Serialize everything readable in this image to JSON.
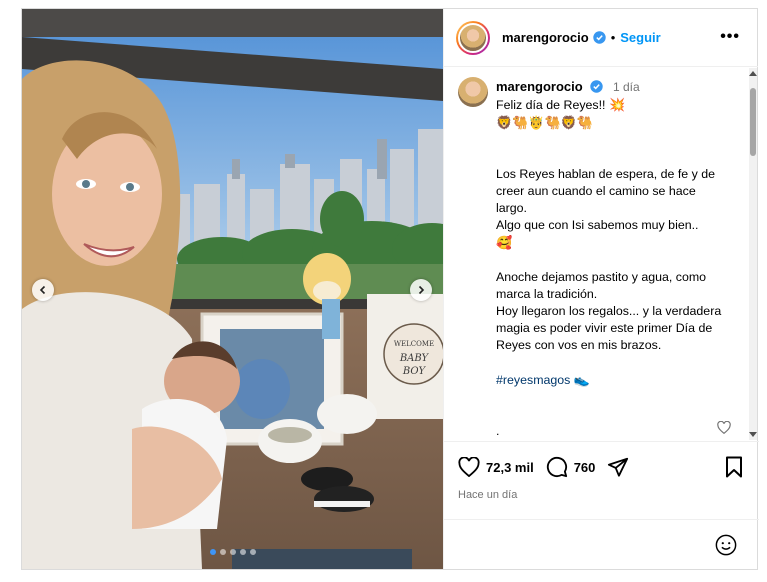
{
  "post": {
    "username": "marengorocio",
    "follow_label": "Seguir",
    "separator": "•",
    "more_label": "•••",
    "time_ago": "1 día",
    "caption_line1": "Feliz día de Reyes!! ",
    "caption_line1_emoji": "💥",
    "caption_emoji_row": "🦁🐫🤴🐫🦁🐫",
    "caption_p1": "Los Reyes hablan de espera, de fe y de creer aun cuando el camino se hace largo.\nAlgo que con Isi sabemos muy bien..",
    "caption_p1_emoji": "🥰",
    "caption_p2": "Anoche dejamos pastito y agua, como marca la tradición.\nHoy llegaron los regalos... y la verdadera magia es poder vivir este primer Día de Reyes con vos en mis brazos.",
    "hashtag": "#reyesmagos",
    "hashtag_emoji": "👟",
    "partial_line": "."
  },
  "stats": {
    "likes": "72,3 mil",
    "comments": "760",
    "posted": "Hace un día"
  },
  "photo": {
    "gift_card_top": "WELCOME",
    "gift_card_mid": "BABY",
    "gift_card_bottom": "BOY",
    "carousel_total": 5,
    "carousel_active": 1
  },
  "colors": {
    "accent": "#0095f6",
    "verified": "#3897f0",
    "muted": "#737373",
    "hashtag": "#00376b"
  }
}
